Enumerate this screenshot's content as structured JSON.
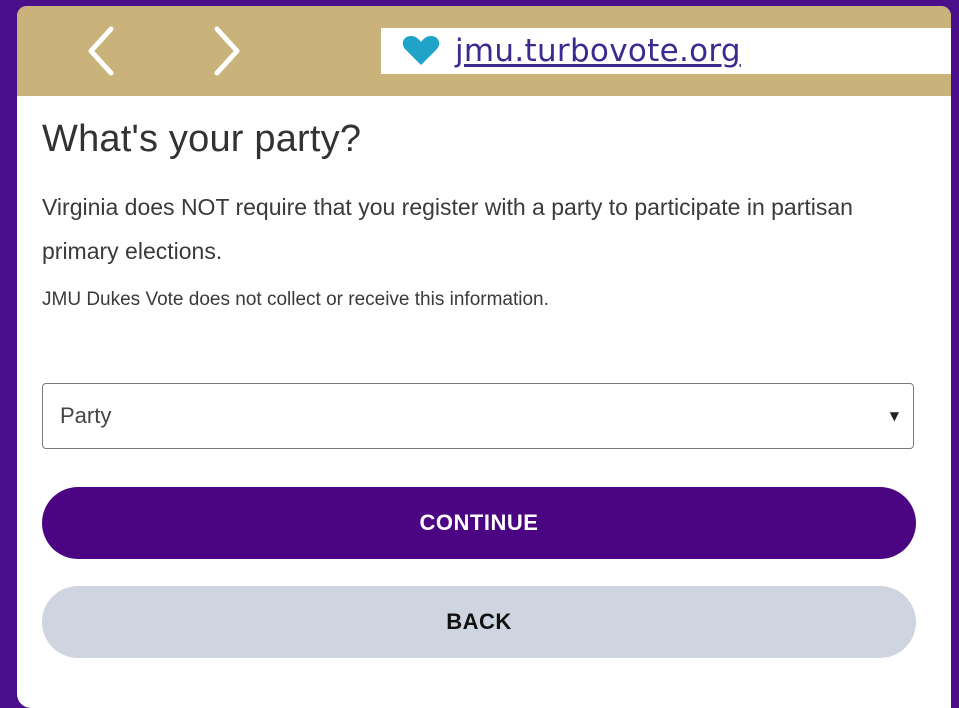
{
  "browser": {
    "url": "jmu.turbovote.org",
    "back_icon": "chevron-left-icon",
    "forward_icon": "chevron-right-icon",
    "site_icon": "heart-icon"
  },
  "page": {
    "title": "What's your party?",
    "intro": "Virginia does NOT require that you register with a party to participate in partisan primary elections.",
    "note": "JMU Dukes Vote does not collect or receive this information."
  },
  "party_select": {
    "value": "Party",
    "icon": "caret-down-icon"
  },
  "buttons": {
    "continue_label": "CONTINUE",
    "back_label": "BACK"
  },
  "colors": {
    "outer_background": "#4a0e8a",
    "browser_bar": "#c9b37a",
    "heart": "#1fa3c9",
    "url_link": "#3b2a8f",
    "continue_button": "#4b0482",
    "back_button": "#cfd5e0"
  }
}
